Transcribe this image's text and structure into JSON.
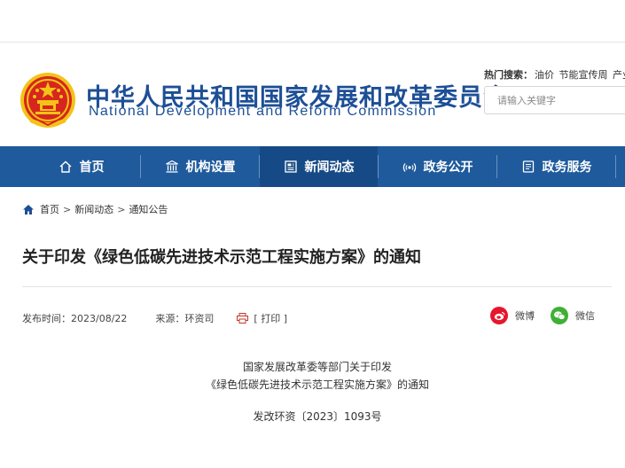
{
  "header": {
    "title_cn": "中华人民共和国国家发展和改革委员会",
    "title_en": "National Development and Reform Commission",
    "hot_search_label": "热门搜索：",
    "hot_search_items": [
      "油价",
      "节能宣传周",
      "产业"
    ],
    "search_placeholder": "请输入关键字"
  },
  "nav": {
    "items": [
      {
        "label": "首页",
        "icon": "home-icon"
      },
      {
        "label": "机构设置",
        "icon": "building-icon"
      },
      {
        "label": "新闻动态",
        "icon": "news-icon"
      },
      {
        "label": "政务公开",
        "icon": "broadcast-icon"
      },
      {
        "label": "政务服务",
        "icon": "service-icon"
      }
    ],
    "active_index": 2
  },
  "breadcrumb": {
    "items": [
      "首页",
      "新闻动态",
      "通知公告"
    ],
    "separator": ">"
  },
  "article": {
    "title": "关于印发《绿色低碳先进技术示范工程实施方案》的通知",
    "publish_time": "发布时间：2023/08/22",
    "source": "来源：环资司",
    "print": "[ 打印 ]",
    "share_weibo": "微博",
    "share_weixin": "微信",
    "doc_line1": "国家发展改革委等部门关于印发",
    "doc_line2": "《绿色低碳先进技术示范工程实施方案》的通知",
    "doc_number": "发改环资〔2023〕1093号"
  },
  "colors": {
    "brand_blue": "#1d4f96",
    "nav_bg": "#1f5a9c",
    "nav_active": "#164a86",
    "emblem_red": "#d7261e",
    "emblem_gold": "#f3c317",
    "weibo_red": "#e6162d",
    "weixin_green": "#3fb035"
  }
}
